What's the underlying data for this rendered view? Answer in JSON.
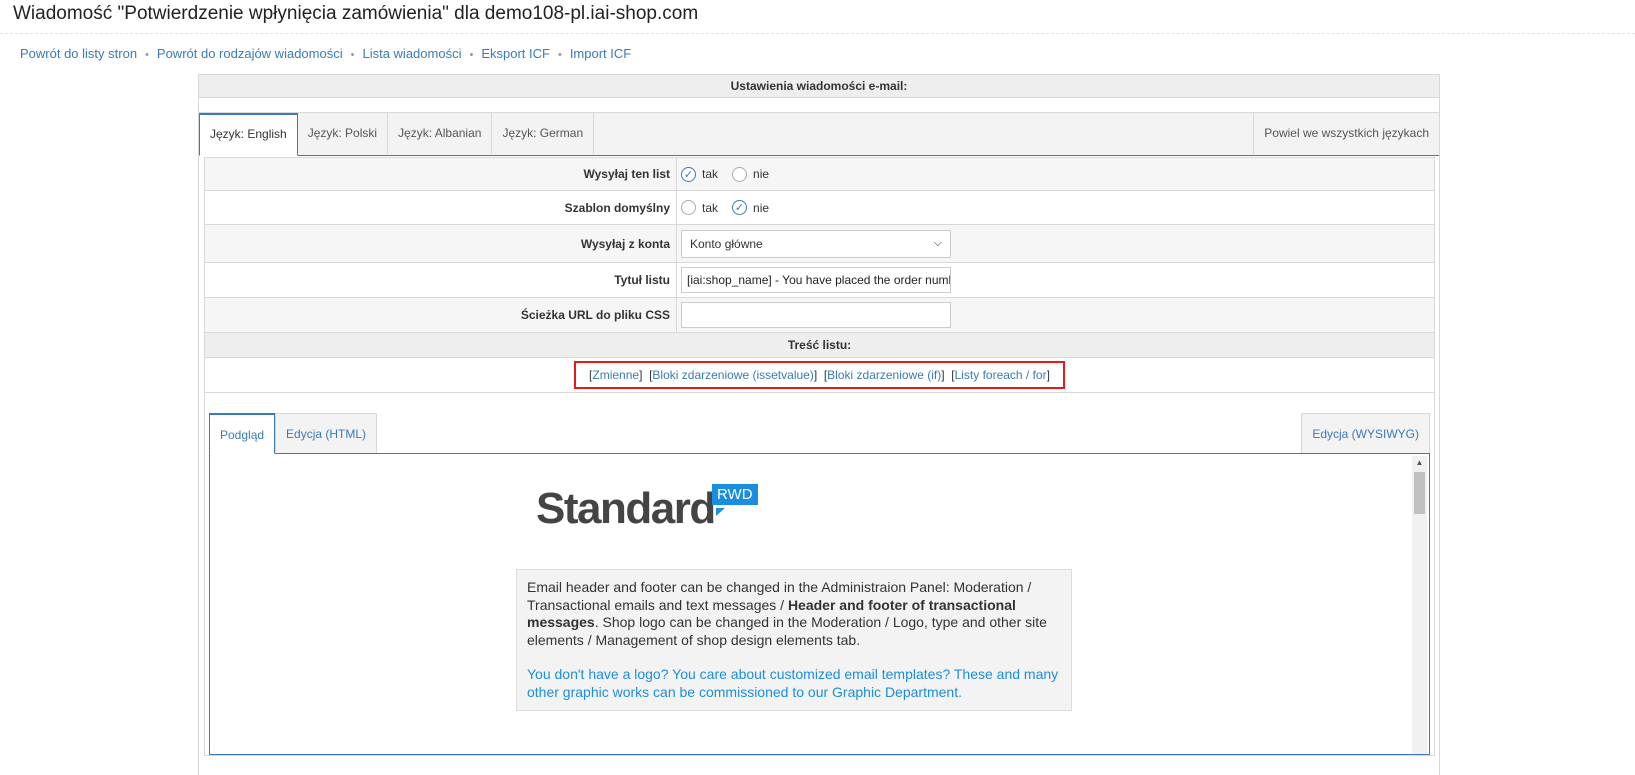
{
  "page": {
    "title": "Wiadomość \"Potwierdzenie wpłynięcia zamówienia\" dla demo108-pl.iai-shop.com"
  },
  "topnav": {
    "links": [
      "Powrót do listy stron",
      "Powrót do rodzajów wiadomości",
      "Lista wiadomości",
      "Eksport ICF",
      "Import ICF"
    ],
    "separator": "•"
  },
  "panel": {
    "header": "Ustawienia wiadomości e-mail:"
  },
  "language_tabs": {
    "tabs": [
      "Język: English",
      "Język: Polski",
      "Język: Albanian",
      "Język: German"
    ],
    "active": "Język: English",
    "repeat_all": "Powiel we wszystkich językach"
  },
  "form": {
    "send_letter": {
      "label": "Wysyłaj ten list",
      "yes": "tak",
      "no": "nie",
      "selected": "tak"
    },
    "default_template": {
      "label": "Szablon domyślny",
      "yes": "tak",
      "no": "nie",
      "selected": "nie"
    },
    "send_from": {
      "label": "Wysyłaj z konta",
      "value": "Konto główne"
    },
    "subject": {
      "label": "Tytuł listu",
      "value": "[iai:shop_name] - You have placed the order numb"
    },
    "css_path": {
      "label": "Ścieżka URL do pliku CSS",
      "value": ""
    }
  },
  "content": {
    "header": "Treść listu:",
    "links": [
      "Zmienne",
      "Bloki zdarzeniowe (issetvalue)",
      "Bloki zdarzeniowe (if)",
      "Listy foreach / for"
    ]
  },
  "edit_tabs": {
    "preview": "Podgląd",
    "html": "Edycja (HTML)",
    "wysiwyg": "Edycja (WYSIWYG)",
    "active": "Podgląd"
  },
  "preview": {
    "logo_word": "Standard",
    "logo_badge": "RWD",
    "info_part1": "Email header and footer can be changed in the Administraion Panel: Moderation / Transactional emails and text messages / ",
    "info_bold": "Header and footer of transactional messages",
    "info_part2": ". Shop logo can be changed in the Moderation / Logo, type and other site elements / Management of shop design elements tab.",
    "info_blue": "You don't have a logo? You care about customized email templates? These and many other graphic works can be commissioned to our Graphic Department."
  },
  "colors": {
    "link": "#3a7ab8",
    "highlight_border": "#e8191c",
    "brand_blue": "#1a8ee0"
  }
}
